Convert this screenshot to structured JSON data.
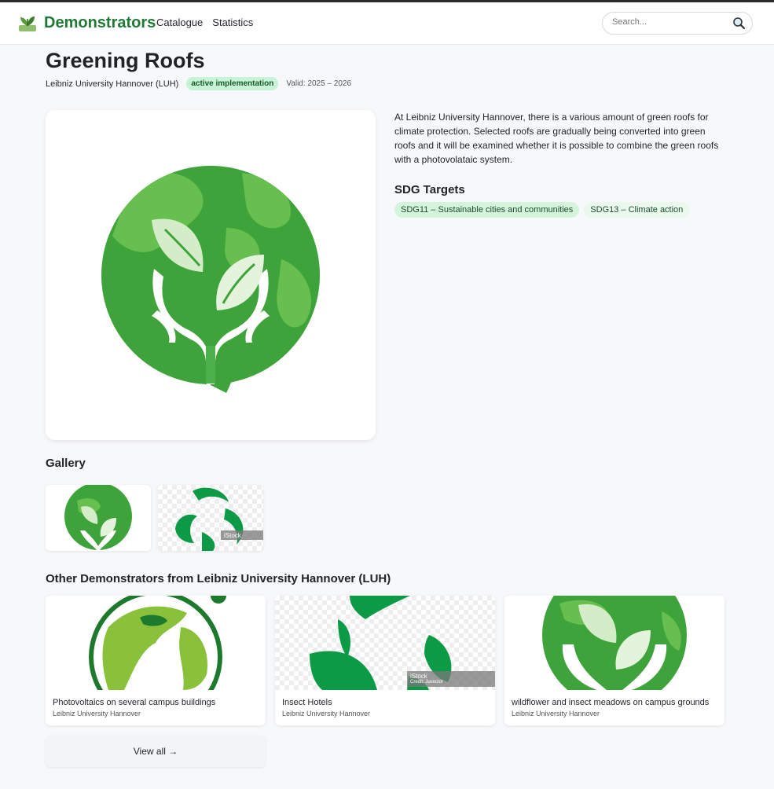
{
  "header": {
    "brand": "Demonstrators",
    "nav": [
      "Catalogue",
      "Statistics"
    ],
    "search_placeholder": "Search..."
  },
  "project": {
    "title": "Greening Roofs",
    "organization": "Leibniz University Hannover (LUH)",
    "status": "active implementation",
    "valid": "Valid: 2025 – 2026",
    "description": "At Leibniz University Hannover, there is a various amount of green roofs for climate protection. Selected roofs are gradually being converted into green roofs and it will be examined whether it is possible to combine the green roofs with a photovolataic system.",
    "sdg_title": "SDG Targets",
    "sdgs": [
      "SDG11 – Sustainable cities and communities",
      "SDG13 – Climate action"
    ]
  },
  "gallery": {
    "title": "Gallery",
    "watermark": "iStock"
  },
  "other": {
    "title": "Other Demonstrators from Leibniz University Hannover (LUH)",
    "items": [
      {
        "name": "Photovoltaics on several campus buildings",
        "org": "Leibniz University Hannover"
      },
      {
        "name": "Insect Hotels",
        "org": "Leibniz University Hannover",
        "watermark": "iStock",
        "credit": "Credit: Juvector"
      },
      {
        "name": "wildflower and insect meadows on campus grounds",
        "org": "Leibniz University Hannover"
      }
    ],
    "view_all": "View all →"
  },
  "colors": {
    "brand": "#1f7a35",
    "badge_bg": "#c9f3d6",
    "globe_dark": "#3ea33a",
    "globe_light": "#62bb4e"
  }
}
